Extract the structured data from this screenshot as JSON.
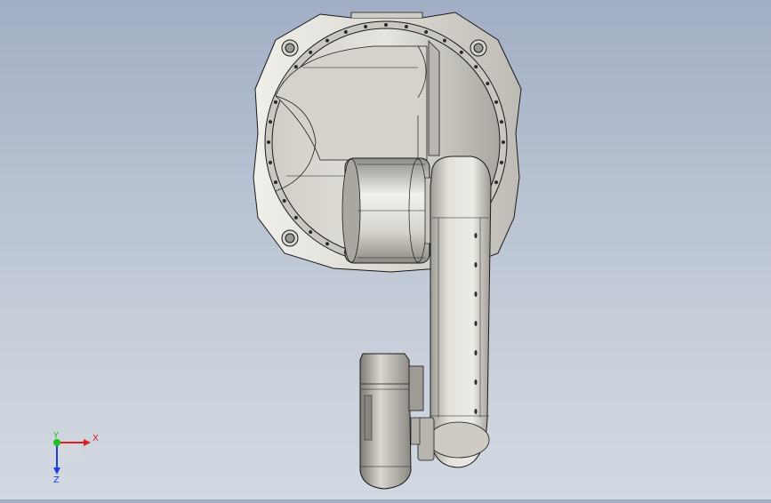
{
  "view": {
    "background_top": "#a2aec4",
    "background_bottom": "#d3d9e2",
    "part_color": "#dddbd4",
    "edge_color": "#1a1a1a"
  },
  "triad": {
    "x_label": "X",
    "y_label": "Y",
    "z_label": "Z",
    "x_color": "#e02020",
    "y_color": "#20c020",
    "z_color": "#2040e0"
  }
}
